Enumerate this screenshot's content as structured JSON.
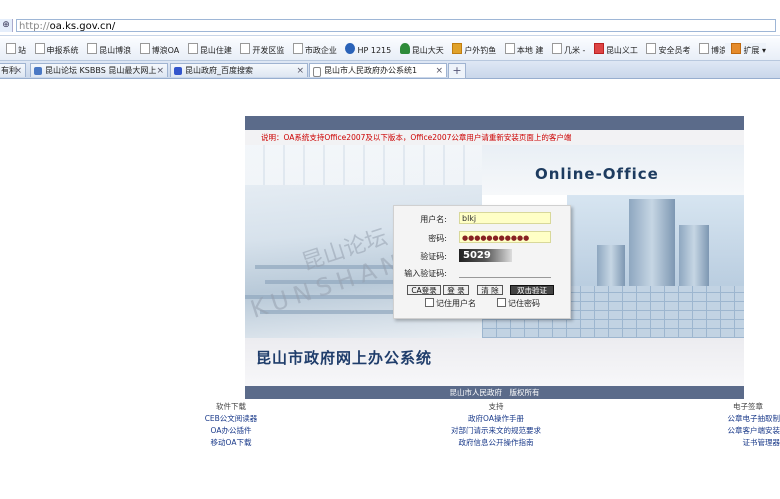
{
  "browser": {
    "url_prefix": "http://",
    "url_host": "oa.ks.gov.cn/",
    "bookmarks": [
      "站",
      "申报系统",
      "昆山博浪",
      "博浪OA",
      "昆山住建",
      "开发区监",
      "市政企业",
      "HP 1215",
      "昆山大天",
      "户外钓鱼",
      "本地 建",
      "几米 -",
      "昆山义工",
      "安全员考",
      "博浪安全",
      "»"
    ],
    "extensions_label": "扩展",
    "tabs": [
      {
        "label": "有利",
        "active": false
      },
      {
        "label": "昆山论坛 KSBBS 昆山最大网上",
        "active": false
      },
      {
        "label": "昆山政府_百度搜索",
        "active": false
      },
      {
        "label": "昆山市人民政府办公系统1",
        "active": true
      }
    ],
    "new_tab_label": "+"
  },
  "page": {
    "notice": "说明：OA系统支持Office2007及以下版本，Office2007公章用户请重新安装页面上的客户端",
    "brand": "Online-Office",
    "system_title": "昆山市政府网上办公系统",
    "footer": "昆山市人民政府　版权所有",
    "watermark_cn": "昆山论坛",
    "watermark_en": "KUNSHAN.DO",
    "login": {
      "username_label": "用户名:",
      "username_value": "blkj",
      "password_label": "密码:",
      "password_value": "●●●●●●●●●●●",
      "captcha_label": "验证码:",
      "captcha_value": "5029",
      "captcha_input_label": "输入验证码:",
      "buttons": [
        "CA登录",
        "登 录",
        "清 除",
        "双击验证"
      ],
      "remember_user": "记住用户名",
      "remember_password": "记住密码"
    },
    "link_groups": [
      {
        "heading": "软件下载",
        "items": [
          "CEB公文阅读器",
          "OA办公插件",
          "移动OA下载"
        ]
      },
      {
        "heading": "支持",
        "items": [
          "政府OA操作手册",
          "对部门请示来文的规范要求",
          "政府信息公开操作指南"
        ]
      },
      {
        "heading": "电子签章",
        "items": [
          "公章电子抽取制",
          "公章客户端安装",
          "证书管理器"
        ]
      }
    ]
  }
}
